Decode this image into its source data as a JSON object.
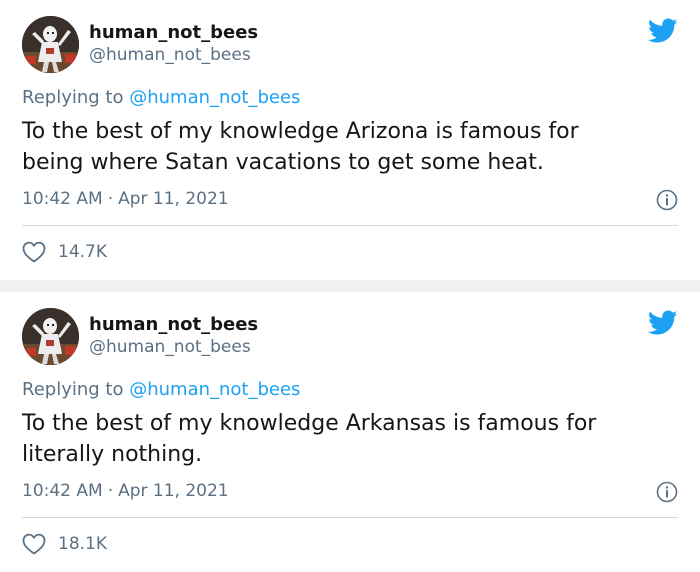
{
  "colors": {
    "brand": "#1da1f2",
    "muted_text": "#5b7083",
    "text": "#14171a",
    "divider": "#cfd9de"
  },
  "tweets": [
    {
      "author": {
        "name": "human_not_bees",
        "handle": "@human_not_bees",
        "avatar_icon": "avatar-image"
      },
      "replying_prefix": "Replying to",
      "replying_to": "@human_not_bees",
      "text": "To the best of my knowledge Arizona is famous for\nbeing where Satan vacations to get some heat.",
      "time": "10:42 AM",
      "separator": "·",
      "date": "Apr 11, 2021",
      "likes": "14.7K",
      "icons": [
        "twitter-bird-icon",
        "info-icon",
        "heart-icon"
      ]
    },
    {
      "author": {
        "name": "human_not_bees",
        "handle": "@human_not_bees",
        "avatar_icon": "avatar-image"
      },
      "replying_prefix": "Replying to",
      "replying_to": "@human_not_bees",
      "text": "To the best of my knowledge Arkansas is famous for\nliterally nothing.",
      "time": "10:42 AM",
      "separator": "·",
      "date": "Apr 11, 2021",
      "likes": "18.1K",
      "icons": [
        "twitter-bird-icon",
        "info-icon",
        "heart-icon"
      ]
    }
  ]
}
